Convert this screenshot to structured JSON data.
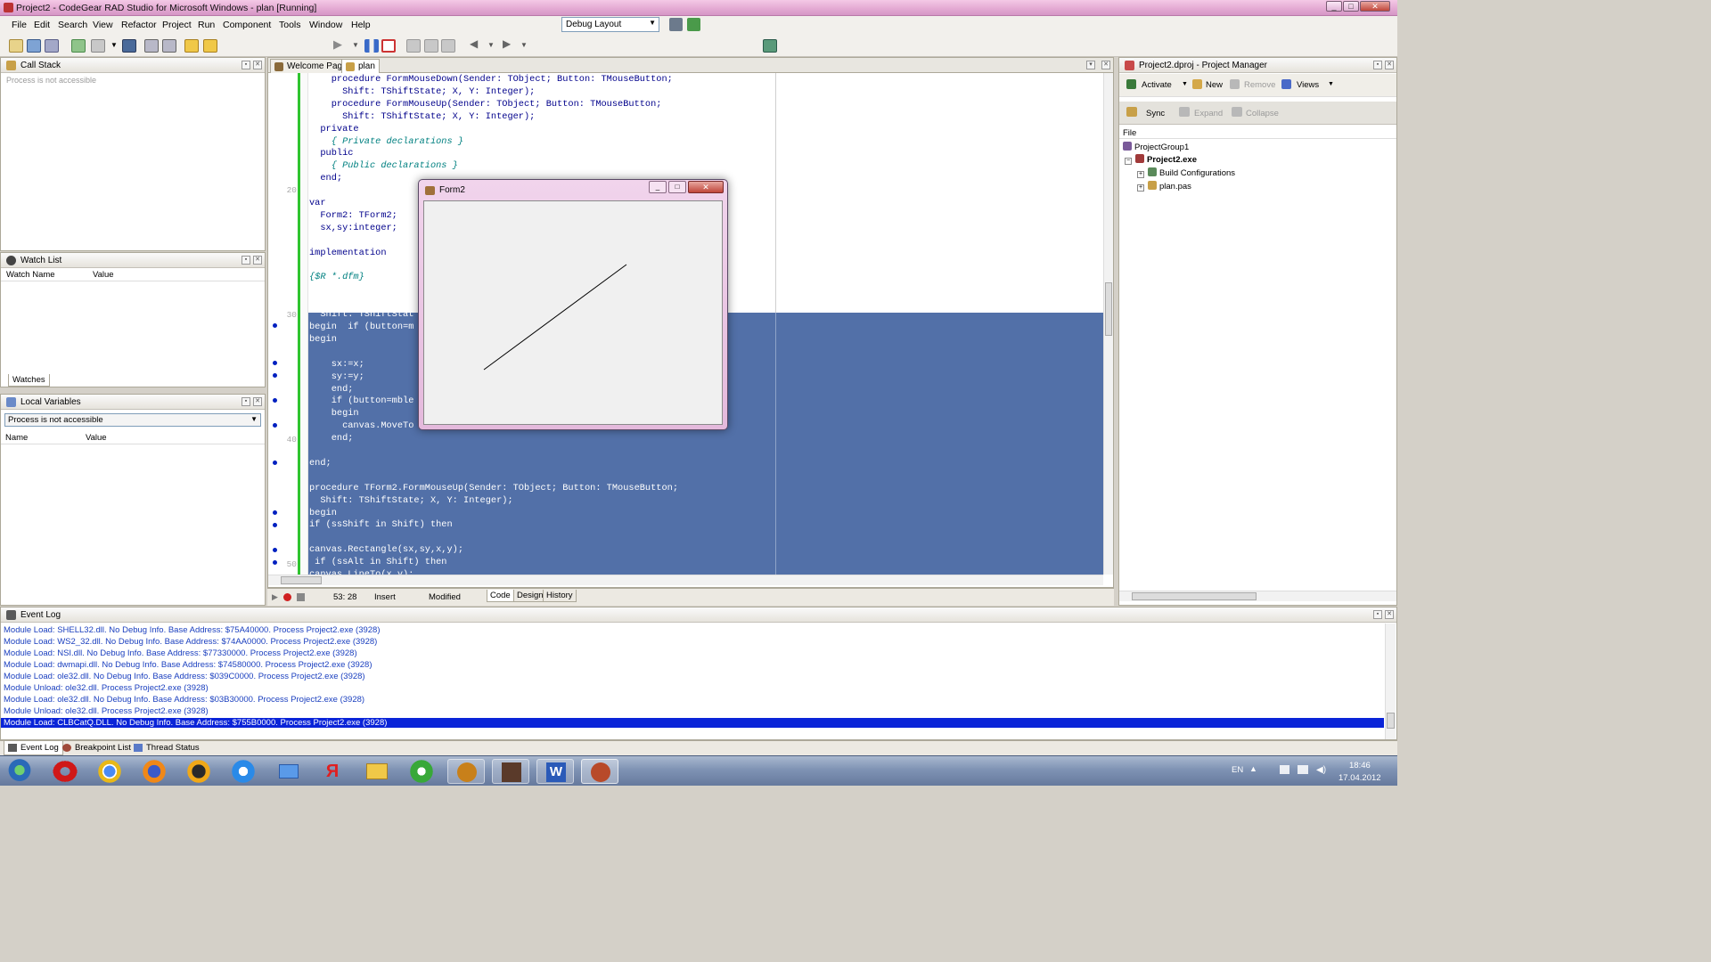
{
  "window": {
    "title": "Project2 - CodeGear RAD Studio for Microsoft Windows - plan [Running]",
    "minimize": "_",
    "restore": "□",
    "close": "✕"
  },
  "menu": [
    "File",
    "Edit",
    "Search",
    "View",
    "Refactor",
    "Project",
    "Run",
    "Component",
    "Tools",
    "Window",
    "Help"
  ],
  "layout_select": {
    "value": "Debug Layout"
  },
  "call_stack": {
    "title": "Call Stack",
    "message": "Process is not accessible"
  },
  "watch_list": {
    "title": "Watch List",
    "col_name": "Watch Name",
    "col_value": "Value",
    "tab": "Watches"
  },
  "local_vars": {
    "title": "Local Variables",
    "select": "Process is not accessible",
    "col_name": "Name",
    "col_value": "Value"
  },
  "editor": {
    "tabs": [
      "Welcome Page",
      "plan"
    ],
    "line_numbers": [
      "20",
      "30",
      "40",
      "50"
    ],
    "lines": [
      "    procedure FormMouseDown(Sender: TObject; Button: TMouseButton;",
      "      Shift: TShiftState; X, Y: Integer);",
      "    procedure FormMouseUp(Sender: TObject; Button: TMouseButton;",
      "      Shift: TShiftState; X, Y: Integer);",
      "  private",
      "    { Private declarations }",
      "  public",
      "    { Public declarations }",
      "  end;",
      "",
      "var",
      "  Form2: TForm2;",
      "  sx,sy:integer;",
      "",
      "implementation",
      "",
      "{$R *.dfm}",
      "",
      "procedure TForm2.Fo",
      "  Shift: TShiftStat",
      "begin  if (button=m",
      "begin",
      "",
      "    sx:=x;",
      "    sy:=y;",
      "    end;",
      "    if (button=mble",
      "    begin",
      "      canvas.MoveTo",
      "    end;",
      "",
      "end;",
      "",
      "procedure TForm2.FormMouseUp(Sender: TObject; Button: TMouseButton;",
      "  Shift: TShiftState; X, Y: Integer);",
      "begin",
      "if (ssShift in Shift) then",
      "",
      "canvas.Rectangle(sx,sy,x,y);",
      " if (ssAlt in Shift) then",
      "canvas.LineTo(x,y);"
    ],
    "status": {
      "position": "53: 28",
      "mode": "Insert",
      "state": "Modified"
    },
    "view_tabs": [
      "Code",
      "Design",
      "History"
    ]
  },
  "form2": {
    "title": "Form2"
  },
  "project_manager": {
    "title": "Project2.dproj - Project Manager",
    "toolbar": [
      "Activate",
      "New",
      "Remove",
      "Views"
    ],
    "toolbar2": [
      "Sync",
      "Expand",
      "Collapse"
    ],
    "col_file": "File",
    "tree": [
      {
        "label": "ProjectGroup1",
        "level": 0,
        "bold": false
      },
      {
        "label": "Project2.exe",
        "level": 1,
        "bold": true
      },
      {
        "label": "Build Configurations",
        "level": 2,
        "bold": false
      },
      {
        "label": "plan.pas",
        "level": 2,
        "bold": false
      }
    ]
  },
  "event_log": {
    "title": "Event Log",
    "lines": [
      "Module Load: SHELL32.dll. No Debug Info. Base Address: $75A40000. Process Project2.exe (3928)",
      "Module Load: WS2_32.dll. No Debug Info. Base Address: $74AA0000. Process Project2.exe (3928)",
      "Module Load: NSI.dll. No Debug Info. Base Address: $77330000. Process Project2.exe (3928)",
      "Module Load: dwmapi.dll. No Debug Info. Base Address: $74580000. Process Project2.exe (3928)",
      "Module Load: ole32.dll. No Debug Info. Base Address: $039C0000. Process Project2.exe (3928)",
      "Module Unload: ole32.dll. Process Project2.exe (3928)",
      "Module Load: ole32.dll. No Debug Info. Base Address: $03B30000. Process Project2.exe (3928)",
      "Module Unload: ole32.dll. Process Project2.exe (3928)",
      "Module Load: CLBCatQ.DLL. No Debug Info. Base Address: $755B0000. Process Project2.exe (3928)"
    ],
    "selected_index": 8
  },
  "bottom_tabs": [
    "Event Log",
    "Breakpoint List",
    "Thread Status"
  ],
  "taskbar": {
    "lang": "EN",
    "time": "18:46",
    "date": "17.04.2012",
    "apps": [
      "start-orb",
      "opera",
      "chrome",
      "firefox",
      "aimp",
      "internet-explorer",
      "mail",
      "yandex",
      "file-explorer",
      "utorrent",
      "game-helmet",
      "game-face",
      "word",
      "delphi"
    ]
  }
}
